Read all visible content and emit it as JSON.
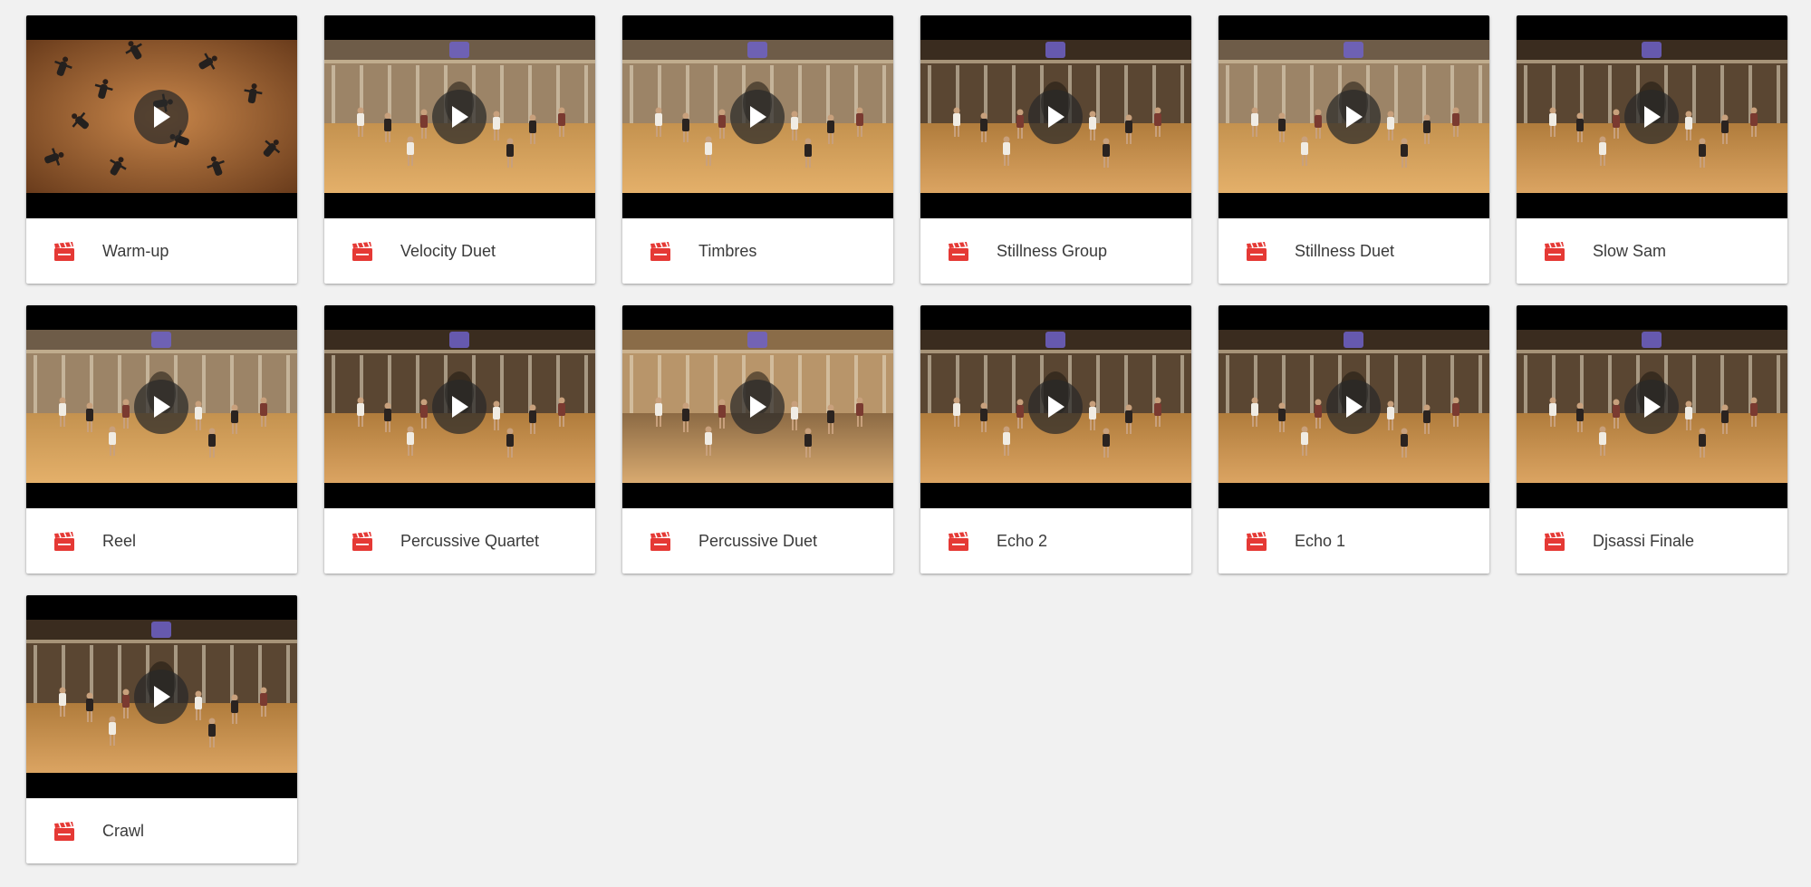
{
  "gallery": {
    "icon_color": "#e53935",
    "videos": [
      {
        "title": "Warm-up",
        "scene": "overhead"
      },
      {
        "title": "Velocity Duet",
        "scene": "hall-bright"
      },
      {
        "title": "Timbres",
        "scene": "hall-bright"
      },
      {
        "title": "Stillness Group",
        "scene": "hall-dark"
      },
      {
        "title": "Stillness Duet",
        "scene": "hall-bright"
      },
      {
        "title": "Slow Sam",
        "scene": "hall-dark"
      },
      {
        "title": "Reel",
        "scene": "hall-bright"
      },
      {
        "title": "Percussive Quartet",
        "scene": "hall-dark"
      },
      {
        "title": "Percussive Duet",
        "scene": "stage"
      },
      {
        "title": "Echo 2",
        "scene": "hall-dark"
      },
      {
        "title": "Echo 1",
        "scene": "hall-dark"
      },
      {
        "title": "Djsassi Finale",
        "scene": "hall-dark"
      },
      {
        "title": "Crawl",
        "scene": "hall-dark"
      }
    ]
  }
}
